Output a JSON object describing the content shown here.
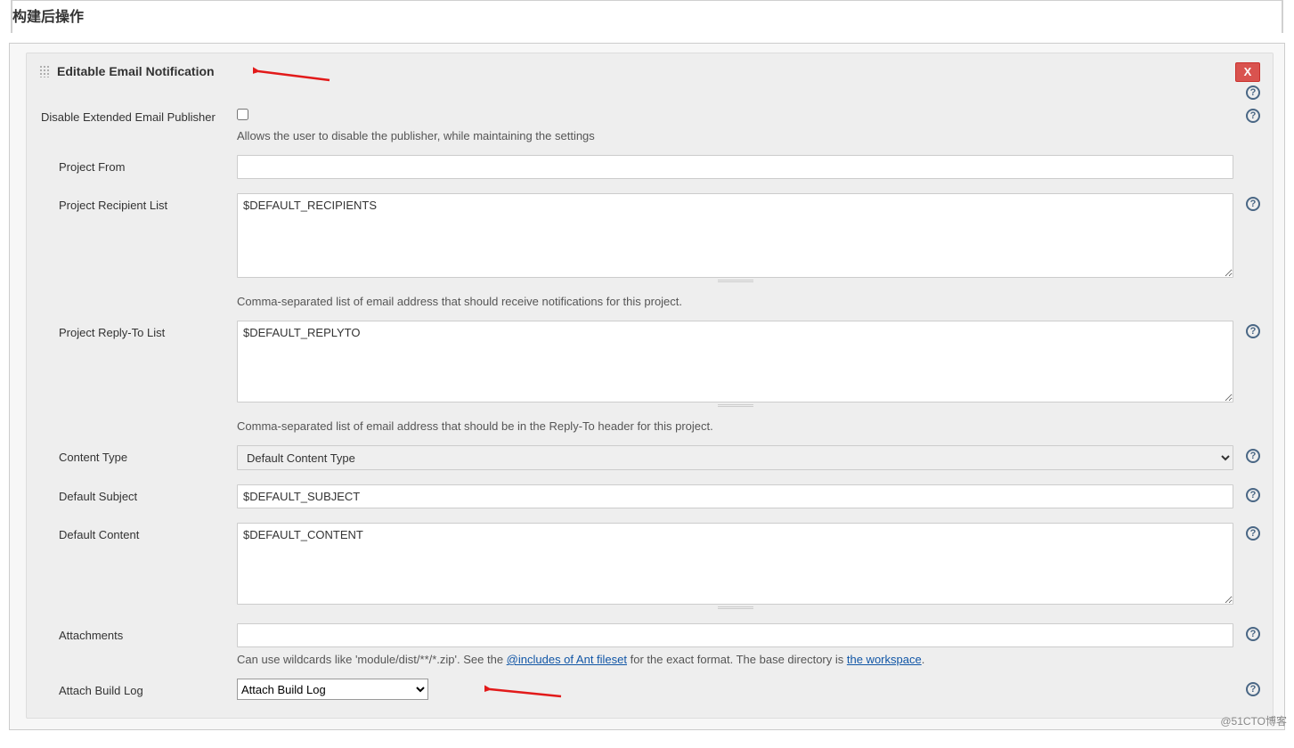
{
  "section_title": "构建后操作",
  "publisher": {
    "title": "Editable Email Notification",
    "delete_label": "X"
  },
  "fields": {
    "disable_publisher": {
      "label": "Disable Extended Email Publisher",
      "hint": "Allows the user to disable the publisher, while maintaining the settings"
    },
    "project_from": {
      "label": "Project From",
      "value": ""
    },
    "recipient_list": {
      "label": "Project Recipient List",
      "value": "$DEFAULT_RECIPIENTS",
      "hint": "Comma-separated list of email address that should receive notifications for this project."
    },
    "replyto_list": {
      "label": "Project Reply-To List",
      "value": "$DEFAULT_REPLYTO",
      "hint": "Comma-separated list of email address that should be in the Reply-To header for this project."
    },
    "content_type": {
      "label": "Content Type",
      "selected": "Default Content Type"
    },
    "default_subject": {
      "label": "Default Subject",
      "value": "$DEFAULT_SUBJECT"
    },
    "default_content": {
      "label": "Default Content",
      "value": "$DEFAULT_CONTENT"
    },
    "attachments": {
      "label": "Attachments",
      "value": "",
      "hint_pre": "Can use wildcards like 'module/dist/**/*.zip'. See the ",
      "hint_link1": "@includes of Ant fileset",
      "hint_mid": " for the exact format. The base directory is ",
      "hint_link2": "the workspace",
      "hint_post": "."
    },
    "attach_build_log": {
      "label": "Attach Build Log",
      "selected": "Attach Build Log"
    }
  },
  "help_tooltip": "?",
  "watermark": "@51CTO博客"
}
